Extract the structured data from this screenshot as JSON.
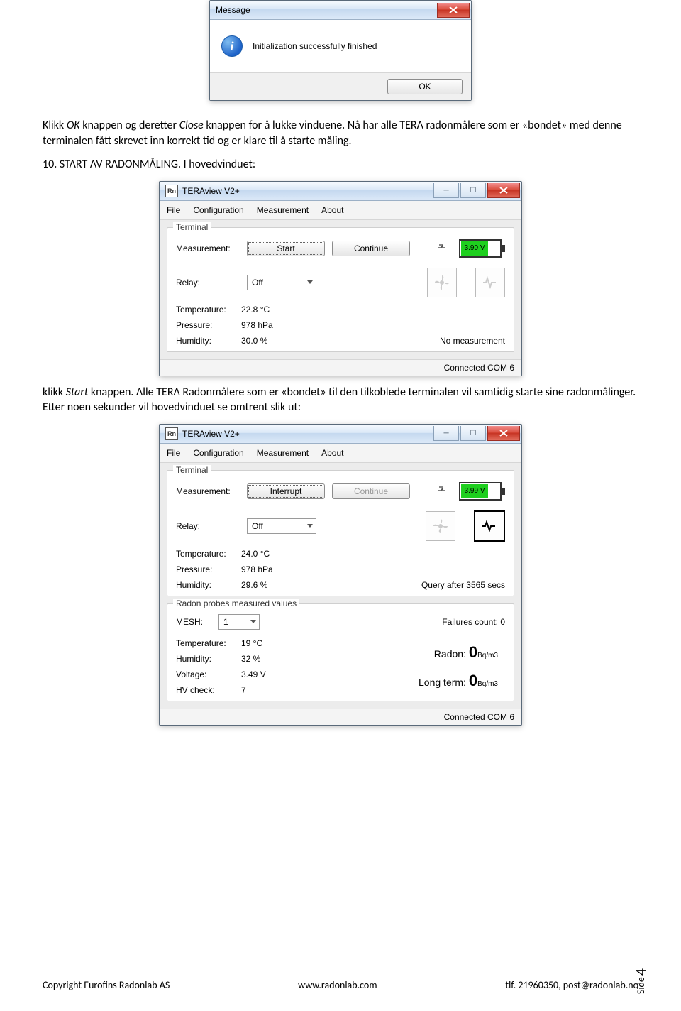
{
  "msgDialog": {
    "title": "Message",
    "text": "Initialization successfully finished",
    "okLabel": "OK"
  },
  "prose1_a": "Klikk ",
  "prose1_b": "OK",
  "prose1_c": " knappen og deretter ",
  "prose1_d": "Close",
  "prose1_e": " knappen for å lukke vinduene. Nå har alle TERA radonmålere som er «bondet» med denne terminalen fått skrevet inn korrekt tid og er klare til å starte måling.",
  "prose2": "10. START AV RADONMÅLING. I hovedvinduet:",
  "prose3_a": "klikk ",
  "prose3_b": "Start",
  "prose3_c": " knappen. Alle TERA Radonmålere som er «bondet» til den tilkoblede terminalen vil samtidig starte sine radonmålinger. Etter noen sekunder vil hovedvinduet se omtrent slik ut:",
  "app": {
    "title": "TERAview V2+",
    "icon": "Rn",
    "menu": [
      "File",
      "Configuration",
      "Measurement",
      "About"
    ],
    "labels": {
      "terminal": "Terminal",
      "measurement": "Measurement:",
      "start": "Start",
      "continue": "Continue",
      "interrupt": "Interrupt",
      "relay": "Relay:",
      "relayValue": "Off",
      "temperature": "Temperature:",
      "pressure": "Pressure:",
      "humidity": "Humidity:",
      "noMeasurement": "No measurement",
      "connected": "Connected COM 6",
      "probesLegend": "Radon probes measured values",
      "mesh": "MESH:",
      "meshValue": "1",
      "failures": "Failures count: 0",
      "voltage": "Voltage:",
      "hvcheck": "HV check:",
      "radon": "Radon:",
      "longterm": "Long term:",
      "zero": "0",
      "unit": "Bq/m3",
      "queryAfter": "Query after 3565 secs"
    },
    "state1": {
      "battery": "3.90 V",
      "temperature": "22.8 °C",
      "pressure": "978 hPa",
      "humidity": "30.0 %"
    },
    "state2": {
      "battery": "3.99 V",
      "temperature": "24.0 °C",
      "pressure": "978 hPa",
      "humidity": "29.6 %",
      "probeTemp": "19 °C",
      "probeHum": "32 %",
      "probeVolt": "3.49 V",
      "probeHv": "7"
    }
  },
  "footer": {
    "copyright": "Copyright Eurofins Radonlab AS",
    "web": "www.radonlab.com",
    "contact": "tlf. 21960350, post@radonlab.no",
    "sideLabel": "Side",
    "sideNum": "4"
  }
}
